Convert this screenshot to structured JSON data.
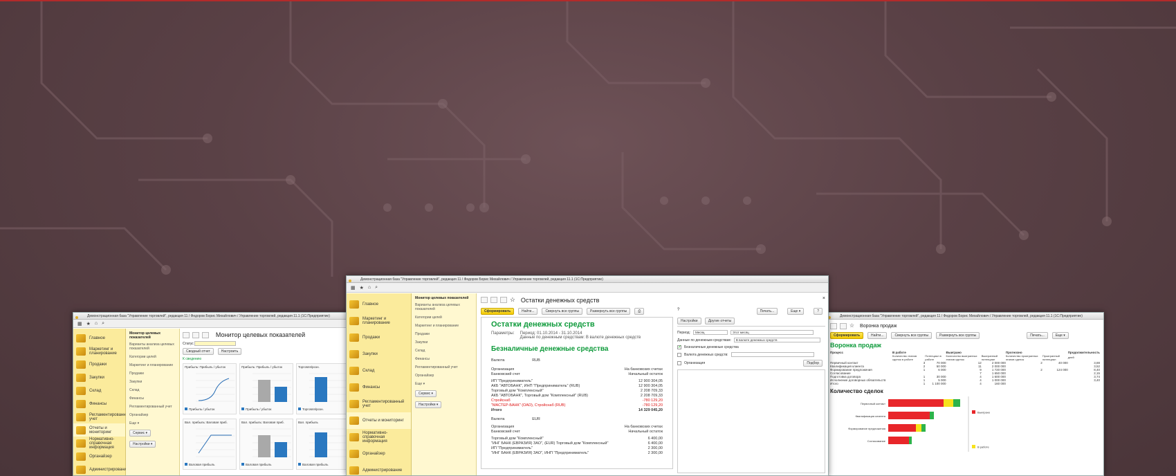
{
  "colors": {
    "background": "#5a4146",
    "sidebar": "#fbeb9c",
    "accent_green": "#0d9a3a",
    "accent_red": "#d11",
    "button_yellow": "#f2c800",
    "funnel_red": "#e8262a",
    "funnel_yellow": "#f7e21c",
    "funnel_green": "#2db34a"
  },
  "left_window": {
    "titlebar": "Демонстрационная база \"Управление торговлей\", редакция 11 / Федоров Борис Михайлович / Управление торговлей, редакция 11.1 (1С:Предприятие)",
    "sidebar": [
      {
        "label": "Главное",
        "icon": "home-icon"
      },
      {
        "label": "Маркетинг и планирование",
        "icon": "marketing-icon"
      },
      {
        "label": "Продажи",
        "icon": "sales-icon"
      },
      {
        "label": "Закупки",
        "icon": "purchases-icon"
      },
      {
        "label": "Склад",
        "icon": "warehouse-icon"
      },
      {
        "label": "Финансы",
        "icon": "finance-icon"
      },
      {
        "label": "Регламентированный учет",
        "icon": "accounting-icon"
      },
      {
        "label": "Отчеты и мониторинг",
        "icon": "reports-icon"
      },
      {
        "label": "Нормативно-справочная информация",
        "icon": "reference-icon"
      },
      {
        "label": "Органайзер",
        "icon": "organizer-icon"
      },
      {
        "label": "Администрирование",
        "icon": "admin-icon"
      }
    ],
    "submenu": {
      "header": "Монитор целевых показателей",
      "items": [
        "Варианты анализа целевых показателей",
        "Категории целей",
        "Маркетинг и планирование",
        "Продажи",
        "Закупки",
        "Склад",
        "Финансы",
        "Регламентированный учет",
        "Органайзер",
        "Еще ▾"
      ],
      "service_label": "Сервис ▾",
      "settings_label": "Настройки ▾"
    },
    "doc_title": "Монитор целевых показателей",
    "filter_label": "Статус",
    "btn_summary": "Сводный отчет",
    "btn_configure": "Настроить",
    "section_label": "К сведению",
    "tiles": [
      {
        "title": "Прибыль: Прибыль / убыток",
        "legend": "Прибыль / убыток"
      },
      {
        "title": "Прибыль: Прибыль / убыток",
        "legend": "Прибыль / убыток"
      },
      {
        "title": "Торговля/розн.",
        "legend": "Торговля/розн."
      },
      {
        "title": "Вал. прибыль: Валовая приб.",
        "legend": "Валовая прибыль"
      },
      {
        "title": "Вал. прибыль: Валовая приб.",
        "legend": "Валовая прибыль"
      },
      {
        "title": "Вал. прибыль",
        "legend": "Валовая прибыль"
      }
    ]
  },
  "center_window": {
    "titlebar": "Демонстрационная база \"Управление торговлей\", редакция 11 / Федоров Борис Михайлович / Управление торговлей, редакция 11.1 (1С:Предприятие)",
    "sidebar": [
      {
        "label": "Главное",
        "icon": "home-icon"
      },
      {
        "label": "Маркетинг и планирование",
        "icon": "marketing-icon"
      },
      {
        "label": "Продажи",
        "icon": "sales-icon"
      },
      {
        "label": "Закупки",
        "icon": "purchases-icon"
      },
      {
        "label": "Склад",
        "icon": "warehouse-icon"
      },
      {
        "label": "Финансы",
        "icon": "finance-icon"
      },
      {
        "label": "Регламентированный учет",
        "icon": "accounting-icon"
      },
      {
        "label": "Отчеты и мониторинг",
        "icon": "reports-icon"
      },
      {
        "label": "Нормативно-справочная информация",
        "icon": "reference-icon"
      },
      {
        "label": "Органайзер",
        "icon": "organizer-icon"
      },
      {
        "label": "Администрирование",
        "icon": "admin-icon"
      }
    ],
    "submenu": {
      "header": "Монитор целевых показателей",
      "items": [
        "Варианты анализа целевых показателей",
        "Категории целей",
        "Маркетинг и планирование",
        "Продажи",
        "Закупки",
        "Склад",
        "Финансы",
        "Регламентированный учет",
        "Органайзер",
        "Еще ▾"
      ],
      "service_label": "Сервис ▾",
      "settings_label": "Настройки ▾"
    },
    "doc_title": "Остатки денежных средств",
    "btn_generate": "Сформировать",
    "btn_find": "Найти...",
    "btn_collapse": "Свернуть все группы",
    "btn_expand": "Развернуть все группы",
    "btn_print": "Печать...",
    "btn_more": "Еще ▾",
    "btn_help": "?",
    "report_title": "Остатки денежных средств",
    "params_label": "Параметры:",
    "params_line1": "Период: 01.10.2014 - 31.10.2014",
    "params_line2": "Данные по денежным средствам: В валюте денежных средств",
    "section_title": "Безналичные денежные средства",
    "currency_label": "Валюта",
    "currency_value": "RUB",
    "org_label": "Организация",
    "bank_label": "Банковский счет",
    "on_bank": "На банковских счетах",
    "start_balance": "Начальный остаток",
    "rows_1": [
      {
        "name": "ИП \"Предприниматель\"",
        "value": "12 900 304,05",
        "red": false
      },
      {
        "name": "АКБ \"АВТОБАНК\", ИНП \"Предприниматель\" (RUB)",
        "value": "12 900 304,05",
        "red": false
      },
      {
        "name": "Торговый дом \"Комплексный\"",
        "value": "2 208 709,33",
        "red": false
      },
      {
        "name": "АКБ \"АВТОБАНК\", Торговый дом \"Комплексный\" (RUB)",
        "value": "2 208 709,33",
        "red": false
      },
      {
        "name": "Стройснаб",
        "value": "-780 129,20",
        "red": true
      },
      {
        "name": "\"МАСТЕР-БАНК\" (ОАО), Стройснаб (RUB)",
        "value": "-780 129,20",
        "red": true
      }
    ],
    "total_label": "Итого",
    "total_value": "14 329 045,20",
    "rows_2": [
      {
        "name": "Торговый дом \"Комплексный\"",
        "value": "6 400,00"
      },
      {
        "name": "\"ИНГ БАНК (ЕВРАЗИЯ) ЗАО\", (EUR) Торговый дом \"Комплексный\"",
        "value": "6 400,00"
      },
      {
        "name": "ИП \"Предприниматель\"",
        "value": "2 300,00"
      },
      {
        "name": "\"ИНГ БАНК (ЕВРАЗИЯ) ЗАО\", ИНП \"Предприниматель\"",
        "value": "2 300,00"
      }
    ],
    "settings": {
      "tab_settings": "Настройки",
      "tab_other": "Другие отчеты",
      "period_label": "Период:",
      "period_value": "Месяц",
      "period_text": "Этот месяц",
      "data_label": "Данные по денежным средствам:",
      "data_value": "В валюте денежных средств",
      "cashless_label": "Безналичные денежные средства",
      "currency_label": "Валюта денежных средств:",
      "org_label": "Организация",
      "select_btn": "Подбор"
    }
  },
  "right_window": {
    "titlebar": "Демонстрационная база \"Управление торговлей\", редакция 11 / Федоров Борис Михайлович / Управление торговлей, редакция 11.1 (1С:Предприятие)",
    "doc_title": "Воронка продаж",
    "btn_generate": "Сформировать",
    "btn_find": "Найти...",
    "btn_collapse": "Свернуть все группы",
    "btn_expand": "Развернуть все группы",
    "btn_print": "Печать...",
    "btn_more": "Еще ▾",
    "report_title": "Воронка продаж",
    "col_process": "Процесс",
    "col_work": "В работе",
    "col_won": "Выиграно",
    "col_prognosis": "Прогнозно",
    "col_duration": "Продолжительность",
    "sub_cols": [
      "Количество этапов сделок в работе",
      "Потенциал в работе",
      "Количество выигранных этапов сделок",
      "Выигранный потенциал",
      "Количество проигранных этапов сделок",
      "Проигранный потенциал",
      "дней"
    ],
    "rows": [
      {
        "name": "Первичный контакт",
        "c": [
          "3",
          "70 000",
          "12",
          "2 000 000",
          "2",
          "40 000",
          "3,88"
        ]
      },
      {
        "name": "Квалификация клиента",
        "c": [
          "2",
          "50 000",
          "11",
          "2 000 000",
          "",
          "",
          "3,52"
        ]
      },
      {
        "name": "Формирование предложения",
        "c": [
          "1",
          "6 000",
          "9",
          "1 720 000",
          "2",
          "124 000",
          "8,40"
        ]
      },
      {
        "name": "Согласование",
        "c": [
          "",
          "",
          "7",
          "1 650 000",
          "",
          "",
          "2,15"
        ]
      },
      {
        "name": "Подготовка договора",
        "c": [
          "1",
          "30 000",
          "4",
          "1 600 000",
          "",
          "",
          "3,74"
        ]
      },
      {
        "name": "Исполнение договорных обязательств",
        "c": [
          "1",
          "5 000",
          "4",
          "1 000 000",
          "",
          "",
          "3,40"
        ]
      },
      {
        "name": "Итого",
        "c": [
          "1",
          "1 100 000",
          "4",
          "160 000",
          "",
          "",
          ""
        ]
      }
    ],
    "deal_count_title": "Количество сделок",
    "funnel_labels": [
      "Первичный контакт",
      "Квалификация клиента",
      "Формирование предложения",
      "Согласование"
    ],
    "legend_won": "Выиграно",
    "legend_prognosis": "В работе"
  }
}
